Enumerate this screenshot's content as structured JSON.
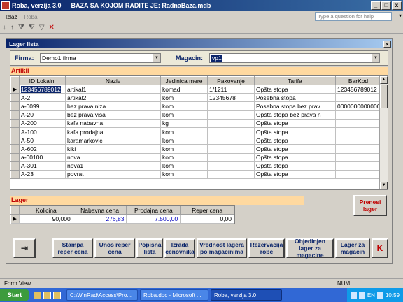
{
  "app": {
    "title": "Roba, verzija 3.0",
    "db_info": "BAZA SA KOJOM RADITE JE: RadnaBaza.mdb",
    "window_buttons": [
      "_",
      "□",
      "x"
    ]
  },
  "menu": {
    "items": [
      "Izlaz",
      "Roba"
    ],
    "help_placeholder": "Type a question for help"
  },
  "child": {
    "title": "Lager lista",
    "firma_label": "Firma:",
    "firma_value": "Demo1 firma",
    "magacin_label": "Magacin:",
    "magacin_value": "vp1"
  },
  "artikli": {
    "section_label": "Artikli",
    "columns": [
      "ID Lokalni",
      "Naziv",
      "Jedinica mere",
      "Pakovanje",
      "Tarifa",
      "BarKod"
    ],
    "rows": [
      [
        "123456789012",
        "artikal1",
        "komad",
        "1/1211",
        "Opšta stopa",
        "123456789012"
      ],
      [
        "A-2",
        "artikal2",
        "kom",
        "12345678",
        "Posebna stopa",
        ""
      ],
      [
        "a-0099",
        "bez prava niza",
        "kom",
        "",
        "Posebna stopa bez prav",
        "0000000000000"
      ],
      [
        "A-20",
        "bez prava visa",
        "kom",
        "",
        "Opšta stopa bez prava n",
        ""
      ],
      [
        "A-200",
        "kafa nabavna",
        "kg",
        "",
        "Opšta stopa",
        ""
      ],
      [
        "A-100",
        "kafa prodajna",
        "kom",
        "",
        "Opšta stopa",
        ""
      ],
      [
        "A-50",
        "karamarkovic",
        "kom",
        "",
        "Opšta stopa",
        ""
      ],
      [
        "A-602",
        "kiki",
        "kom",
        "",
        "Opšta stopa",
        ""
      ],
      [
        "a-00100",
        "nova",
        "kom",
        "",
        "Opšta stopa",
        ""
      ],
      [
        "A-301",
        "nova1",
        "kom",
        "",
        "Opšta stopa",
        ""
      ],
      [
        "A-23",
        "povrat",
        "kom",
        "",
        "Opšta stopa",
        ""
      ]
    ]
  },
  "lager": {
    "section_label": "Lager",
    "columns": [
      "Kolicina",
      "Nabavna cena",
      "Prodajna cena",
      "Reper cena"
    ],
    "row": [
      "90,000",
      "276,83",
      "7.500,00",
      "0,00"
    ],
    "prenesi": "Prenesi lager"
  },
  "buttons": {
    "stampa": "Stampa reper cena",
    "unos": "Unos reper cena",
    "popisna": "Popisna lista",
    "izrada": "Izrada cenovnika",
    "vrednost": "Vrednost lagera po magacinima",
    "rezervacija": "Rezervacija robe",
    "objedinjen": "Objedinjen lager za magacine",
    "lagerza": "Lager za magacin",
    "k": "K"
  },
  "status": {
    "left": "Form View",
    "right": "NUM"
  },
  "taskbar": {
    "start": "Start",
    "tasks": [
      "C:\\WinRad\\Access\\Pro...",
      "Roba.doc - Microsoft ...",
      "Roba, verzija 3.0"
    ],
    "lang": "EN",
    "clock": "10:59"
  }
}
